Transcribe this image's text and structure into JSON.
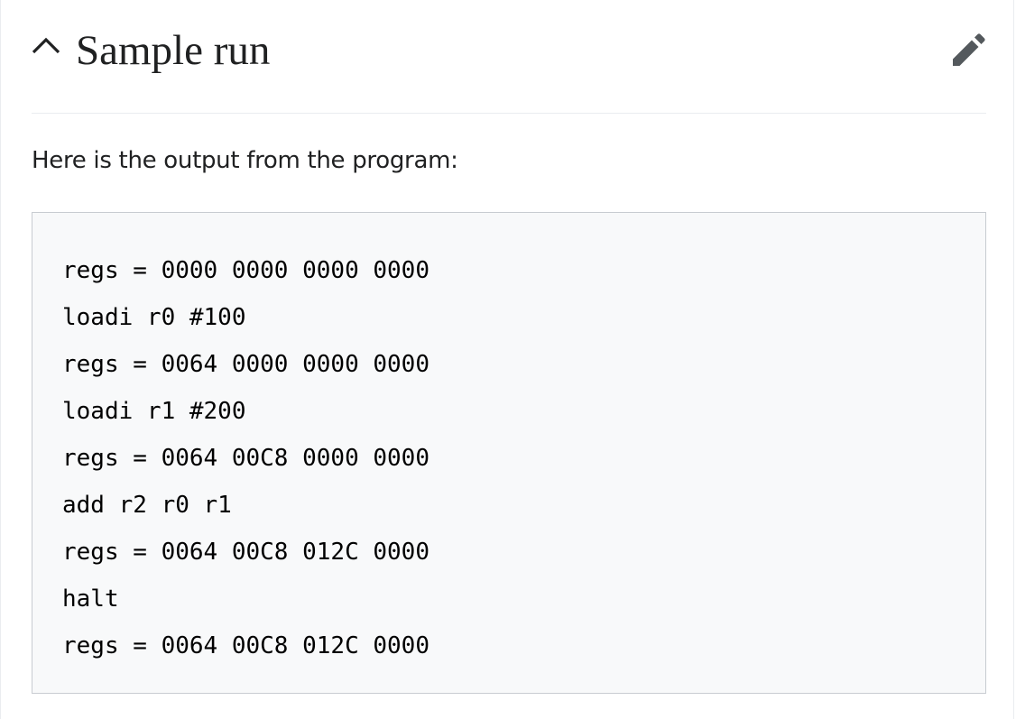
{
  "section": {
    "title": "Sample run",
    "toggle_icon": "chevron-up-icon",
    "edit_icon": "pencil-icon"
  },
  "intro": "Here is the output from the program:",
  "code": {
    "lines": [
      "regs = 0000 0000 0000 0000",
      "loadi r0 #100",
      "regs = 0064 0000 0000 0000",
      "loadi r1 #200",
      "regs = 0064 00C8 0000 0000",
      "add r2 r0 r1",
      "regs = 0064 00C8 012C 0000",
      "halt",
      "regs = 0064 00C8 012C 0000"
    ]
  },
  "colors": {
    "text": "#202122",
    "code_background": "#f8f9fa",
    "code_border": "#c8ccd1",
    "divider": "#eaecf0",
    "icon": "#54595d"
  }
}
